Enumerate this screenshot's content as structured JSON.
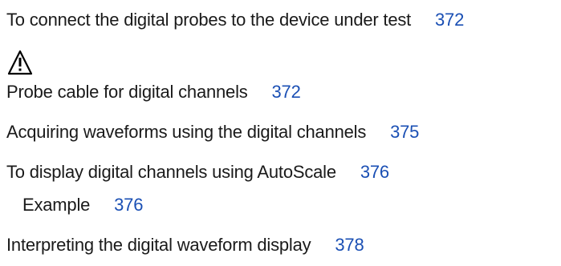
{
  "toc": {
    "entries": [
      {
        "title": "To connect the digital probes to the device under test",
        "page": "372"
      },
      {
        "title": "Probe cable for digital channels",
        "page": "372"
      },
      {
        "title": "Acquiring waveforms using the digital channels",
        "page": "375"
      },
      {
        "title": "To display digital channels using AutoScale",
        "page": "376"
      },
      {
        "title": "Example",
        "page": "376"
      },
      {
        "title": "Interpreting the digital waveform display",
        "page": "378"
      }
    ]
  },
  "icons": {
    "warning": "warning-triangle-icon"
  },
  "colors": {
    "text": "#1a1a1a",
    "page_link": "#1a4fb4"
  }
}
